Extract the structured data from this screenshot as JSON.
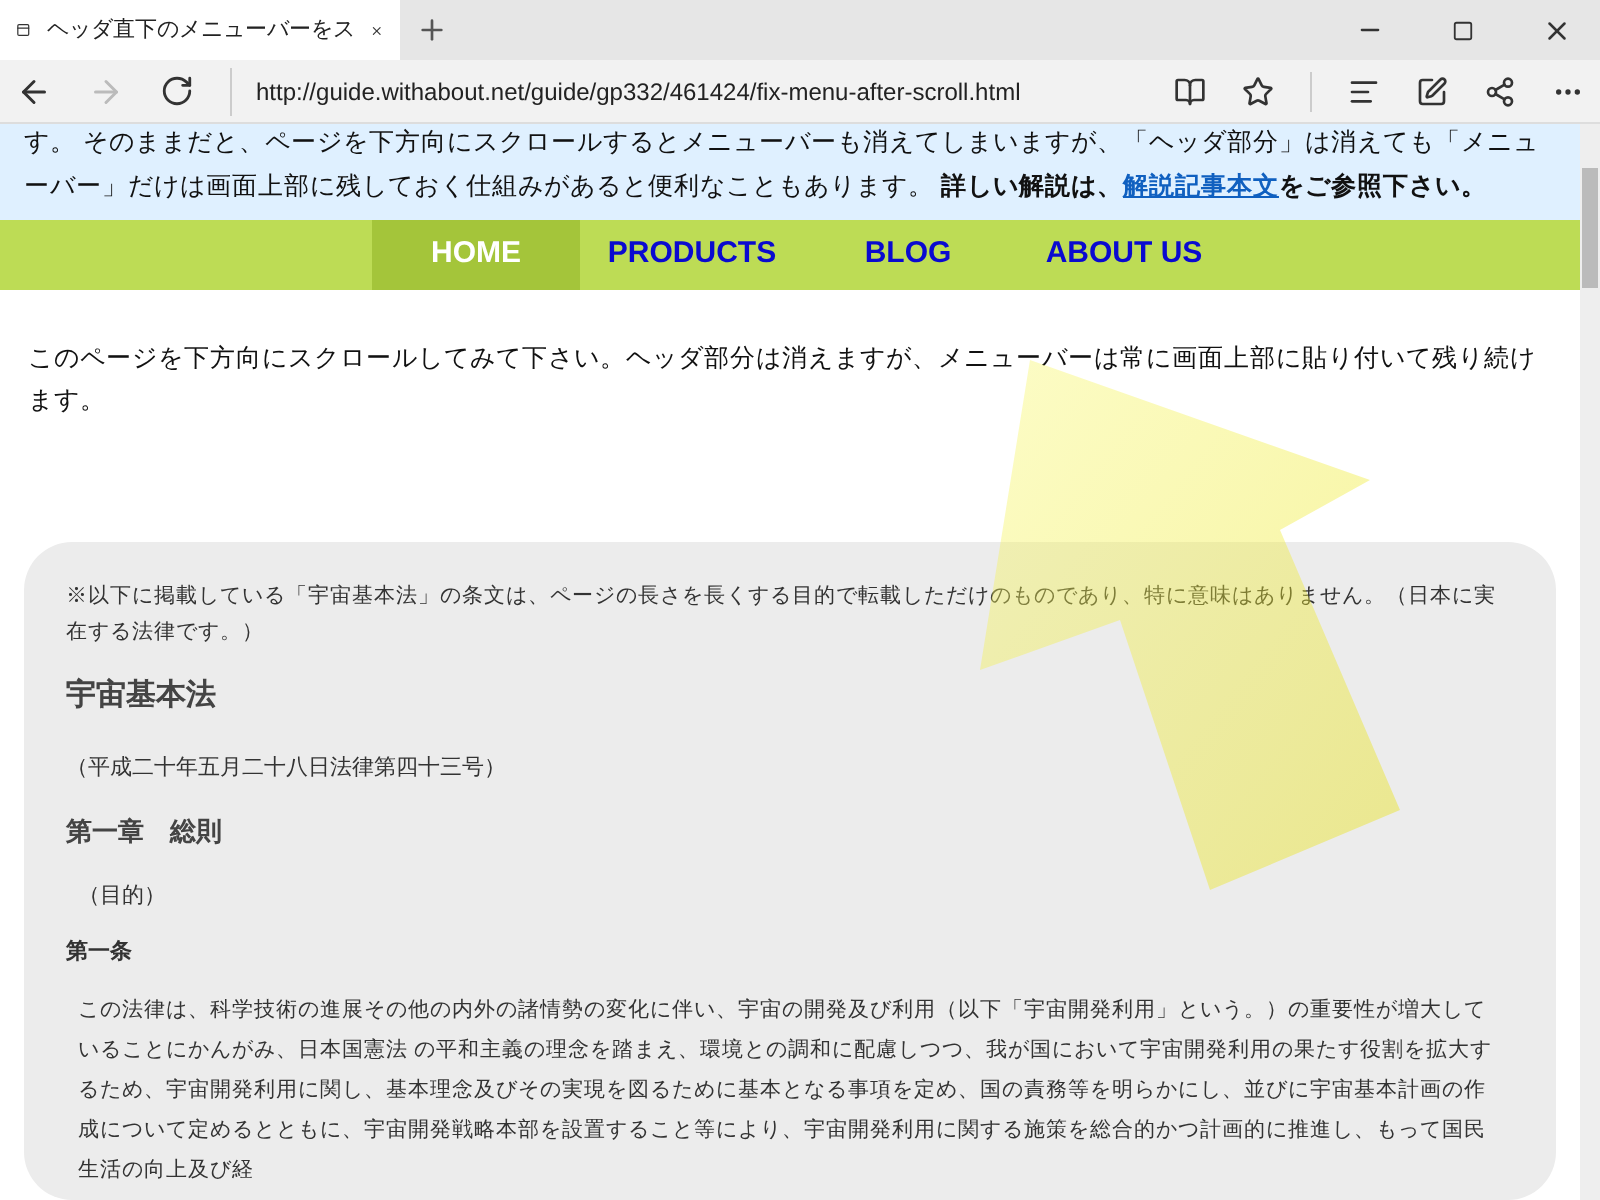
{
  "browser": {
    "tab_title": "ヘッダ直下のメニューバーをス",
    "url": "http://guide.withabout.net/guide/gp332/461424/fix-menu-after-scroll.html"
  },
  "header": {
    "text": "す。 そのままだと、ページを下方向にスクロールするとメニューバーも消えてしまいますが、「ヘッダ部分」は消えても「メニューバー」だけは画面上部に残しておく仕組みがあると便利なこともあります。 **詳しい解説は、**",
    "link": "解説記事本文",
    "after": "をご参照下さい。"
  },
  "nav": [
    {
      "label": "HOME",
      "selected": true
    },
    {
      "label": "PRODUCTS",
      "selected": false
    },
    {
      "label": "BLOG",
      "selected": false
    },
    {
      "label": "ABOUT US",
      "selected": false
    }
  ],
  "intro": "このページを下方向にスクロールしてみて下さい。ヘッダ部分は消えますが、メニューバーは常に画面上部に貼り付いて残り続けます。",
  "article": {
    "note": "※以下に掲載している「宇宙基本法」の条文は、ページの長さを長くする目的で転載しただけのものであり、特に意味はありません。（日本に実在する法律です。）",
    "title": "宇宙基本法",
    "law_number": "（平成二十年五月二十八日法律第四十三号）",
    "chapter": "第一章　総則",
    "caption": "（目的）",
    "article_heading": "第一条",
    "body": "この法律は、科学技術の進展その他の内外の諸情勢の変化に伴い、宇宙の開発及び利用（以下「宇宙開発利用」という。）の重要性が増大していることにかんがみ、日本国憲法 の平和主義の理念を踏まえ、環境との調和に配慮しつつ、我が国において宇宙開発利用の果たす役割を拡大するため、宇宙開発利用に関し、基本理念及びその実現を図るために基本となる事項を定め、国の責務等を明らかにし、並びに宇宙基本計画の作成について定めるとともに、宇宙開発戦略本部を設置すること等により、宇宙開発利用に関する施策を総合的かつ計画的に推進し、もって国民生活の向上及び経"
  }
}
